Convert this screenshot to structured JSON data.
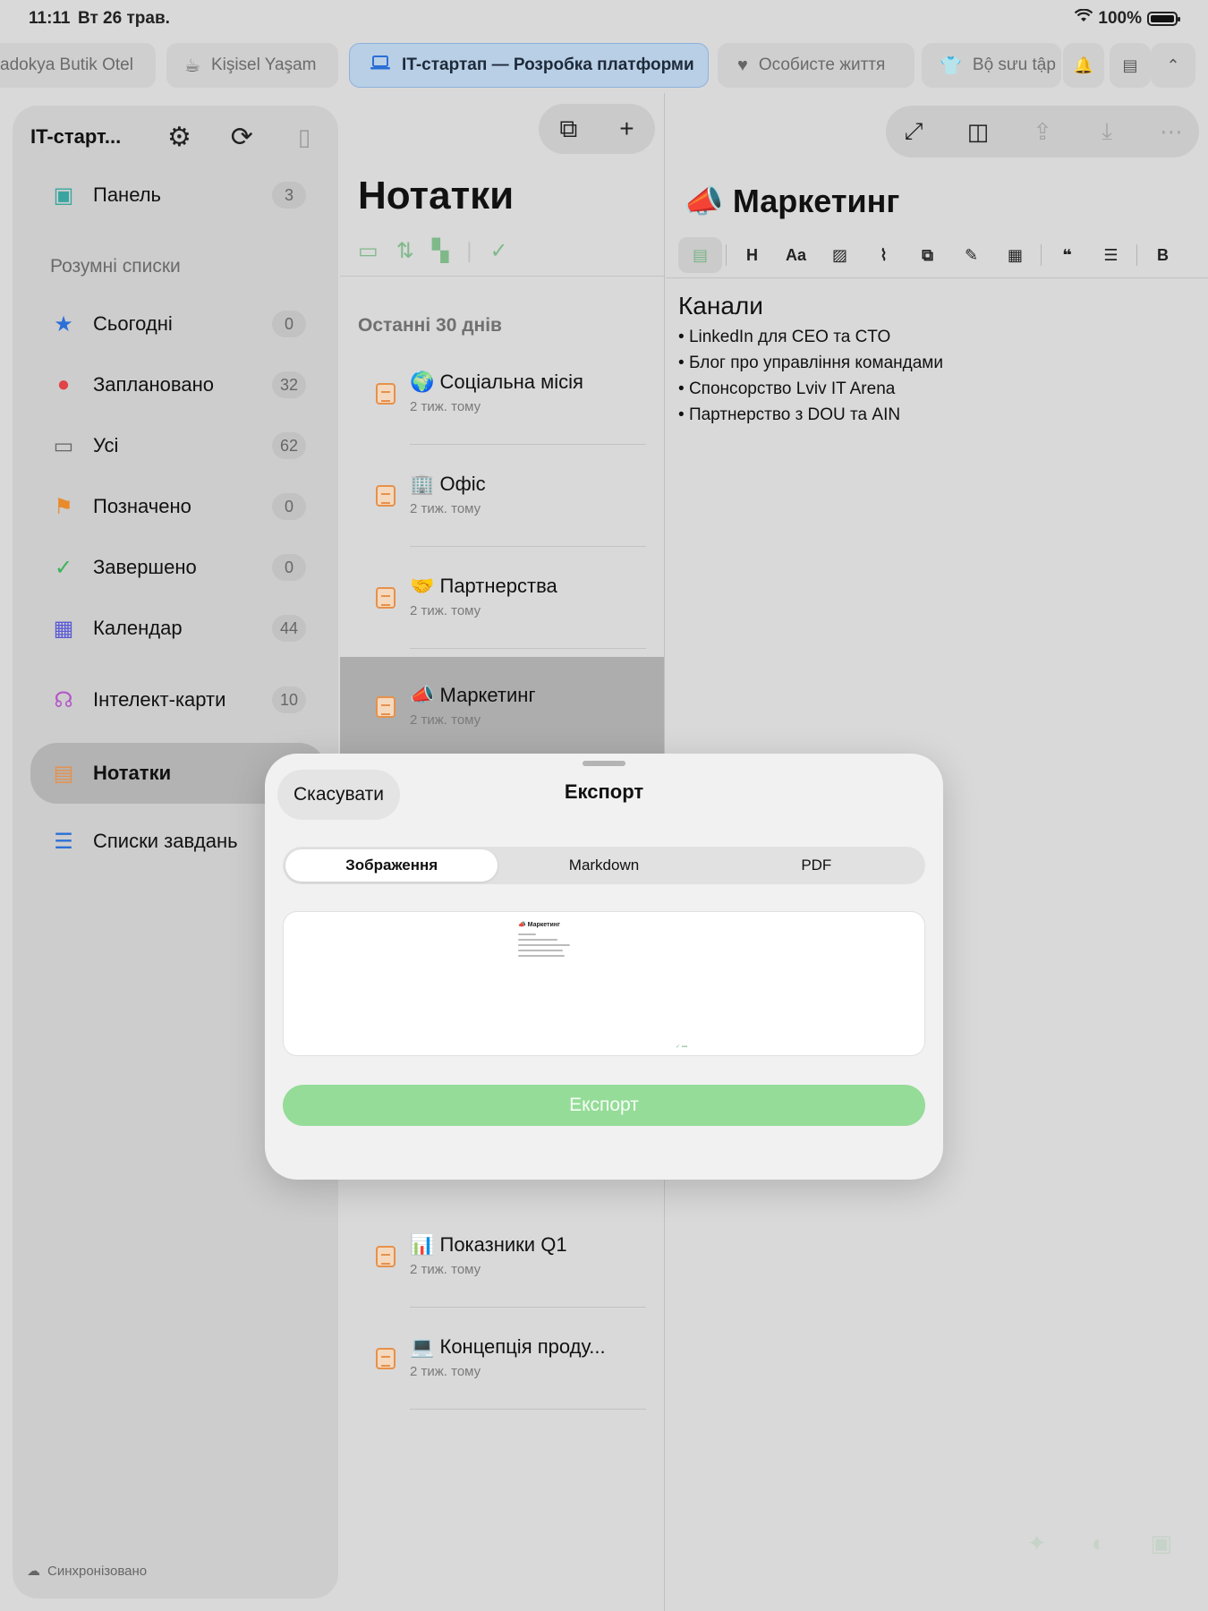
{
  "status": {
    "time": "11:11",
    "date": "Вт 26 трав.",
    "battery": "100%"
  },
  "tabs": [
    {
      "label": "adokya Butik Otel",
      "icon": ""
    },
    {
      "label": "Kişisel Yaşam",
      "icon": "☕"
    },
    {
      "label": "IT-стартап — Розробка платформи",
      "icon": "💻",
      "active": true
    },
    {
      "label": "Особисте життя",
      "icon": "♥"
    },
    {
      "label": "Bộ sưu tập",
      "icon": "👕"
    }
  ],
  "sidebar": {
    "title": "IT-старт...",
    "dashboard": {
      "label": "Панель",
      "count": "3"
    },
    "smart_title": "Розумні списки",
    "items": [
      {
        "label": "Сьогодні",
        "count": "0",
        "icon": "★",
        "color": "#2c6fd7"
      },
      {
        "label": "Заплановано",
        "count": "32",
        "icon": "●",
        "color": "#e04444"
      },
      {
        "label": "Усі",
        "count": "62",
        "icon": "▭",
        "color": "#666666"
      },
      {
        "label": "Позначено",
        "count": "0",
        "icon": "⚑",
        "color": "#e98a2b"
      },
      {
        "label": "Завершено",
        "count": "0",
        "icon": "✓",
        "color": "#3bb45b"
      },
      {
        "label": "Календар",
        "count": "44",
        "icon": "▦",
        "color": "#5a5ad6"
      }
    ],
    "mindmaps": {
      "label": "Інтелект-карти",
      "count": "10"
    },
    "notes": {
      "label": "Нотатки"
    },
    "tasklists": {
      "label": "Списки завдань"
    },
    "sync": "Синхронізовано"
  },
  "notes": {
    "title": "Нотатки",
    "section": "Останні 30 днів",
    "items": [
      {
        "title": "🌍 Соціальна місія",
        "time": "2 тиж. тому"
      },
      {
        "title": "🏢 Офіс",
        "time": "2 тиж. тому"
      },
      {
        "title": "🤝 Партнерства",
        "time": "2 тиж. тому"
      },
      {
        "title": "📣 Маркетинг",
        "time": "2 тиж. тому",
        "selected": true
      },
      {
        "title": "📊 Показники Q1",
        "time": "2 тиж. тому"
      },
      {
        "title": "💻 Концепція проду...",
        "time": "2 тиж. тому"
      }
    ]
  },
  "editor": {
    "title": "📣 Маркетинг",
    "heading": "Канали",
    "bullets": [
      "LinkedIn для CEO та CTO",
      "Блог про управління командами",
      "Спонсорство Lviv IT Arena",
      "Партнерство з DOU та AIN"
    ]
  },
  "modal": {
    "cancel": "Скасувати",
    "title": "Експорт",
    "segments": [
      "Зображення",
      "Markdown",
      "PDF"
    ],
    "preview_title": "📣 Маркетинг",
    "export": "Експорт"
  }
}
